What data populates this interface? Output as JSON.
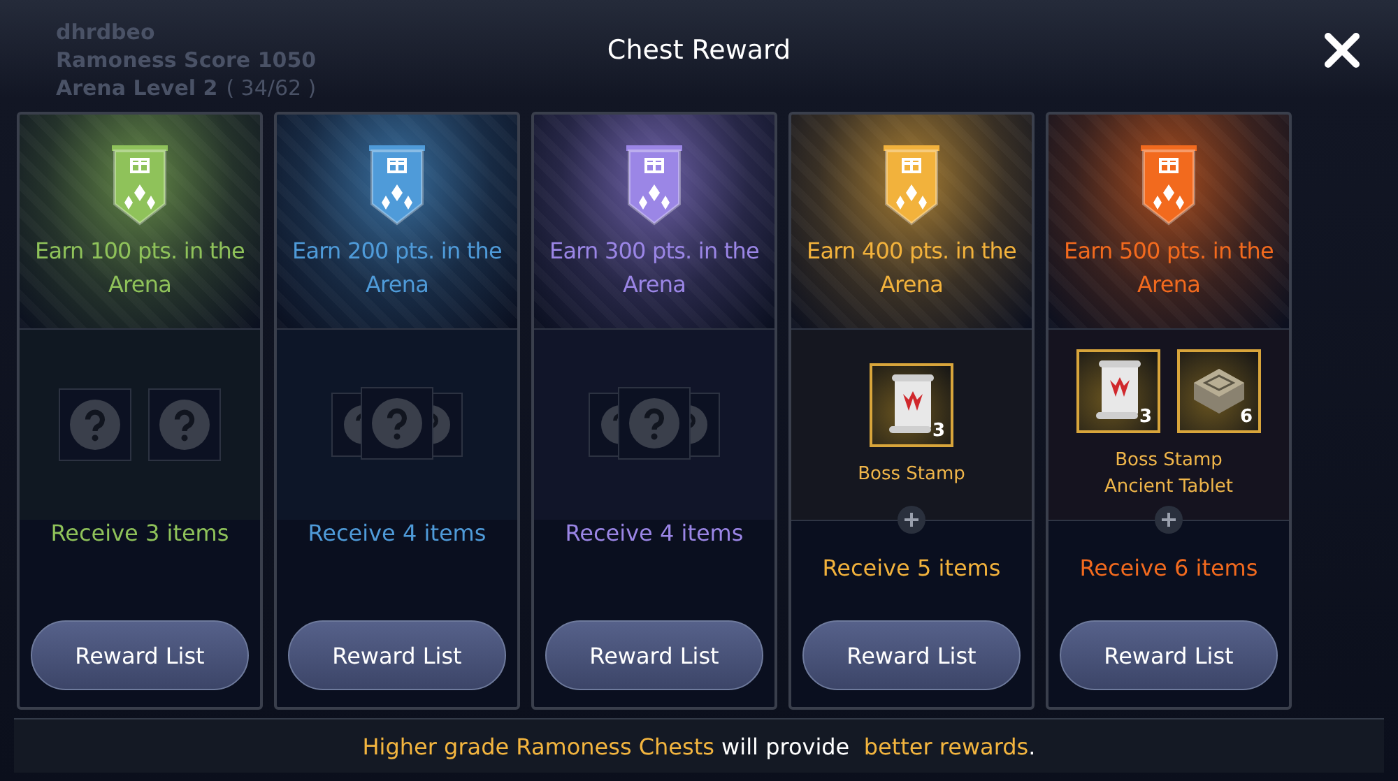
{
  "background": {
    "player_name": "dhrdbeo",
    "score": "Ramoness Score 1050",
    "arena_level": "Arena Level 2",
    "arena_progress": "( 34/62 )"
  },
  "dialog": {
    "title": "Chest Reward"
  },
  "cards": [
    {
      "color": "#8fc25a",
      "goal": "Earn 100 pts. in the Arena",
      "kind": "row",
      "receive": "Receive 3 items",
      "button": "Reward List"
    },
    {
      "color": "#4f9bd9",
      "goal": "Earn 200 pts. in the Arena",
      "kind": "stack",
      "receive": "Receive 4 items",
      "button": "Reward List"
    },
    {
      "color": "#9b86e6",
      "goal": "Earn 300 pts. in the Arena",
      "kind": "stack",
      "receive": "Receive 4 items",
      "button": "Reward List"
    },
    {
      "color": "#f2b23c",
      "goal": "Earn 400 pts. in the Arena",
      "kind": "items",
      "rewards": [
        {
          "kind": "scroll",
          "count": "3"
        }
      ],
      "reward_names": [
        "Boss Stamp"
      ],
      "receive": "Receive 5 items",
      "button": "Reward List"
    },
    {
      "color": "#f26a1e",
      "goal": "Earn 500 pts. in the Arena",
      "kind": "items",
      "rewards": [
        {
          "kind": "scroll",
          "count": "3"
        },
        {
          "kind": "tablet",
          "count": "6"
        }
      ],
      "reward_names": [
        "Boss Stamp",
        "Ancient Tablet"
      ],
      "receive": "Receive 6 items",
      "button": "Reward List"
    }
  ],
  "footer": [
    {
      "text": "Higher grade Ramoness Chests",
      "highlight": true
    },
    {
      "text": " will provide ",
      "highlight": false
    },
    {
      "text": " better rewards",
      "highlight": true
    },
    {
      "text": ".",
      "highlight": false
    }
  ]
}
